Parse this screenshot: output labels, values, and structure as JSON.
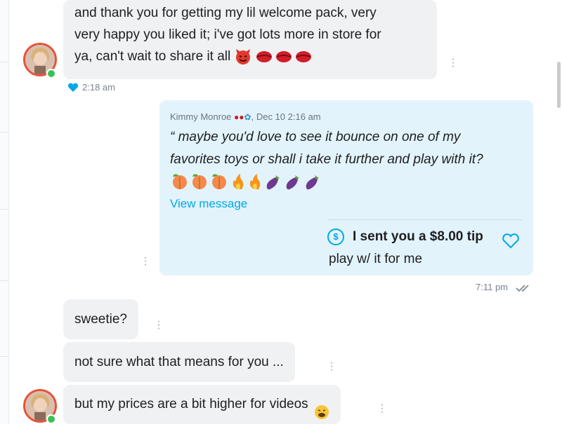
{
  "messages": {
    "welcome": {
      "line1": "and thank you for getting my lil welcome pack, very",
      "line2": "very happy you liked it; i've got lots more in store for",
      "line3": "ya, can't wait to share it all",
      "time": "2:18 am",
      "emojis": [
        "devil-emoji",
        "lips-emoji",
        "lips-emoji",
        "lips-emoji"
      ]
    },
    "quote": {
      "author": "Kimmy Monroe",
      "date": ", Dec 10 2:16 am",
      "line1": "“ maybe you'd love to see it bounce on one of my",
      "line2": "favorites toys or shall i take it further and play with it?",
      "link": "View message",
      "emojis": [
        "peach-emoji",
        "peach-emoji",
        "peach-emoji",
        "fire-emoji",
        "fire-emoji",
        "eggplant-emoji",
        "eggplant-emoji",
        "eggplant-emoji"
      ]
    },
    "tip": {
      "label": "I sent you a $8.00 tip",
      "note": "play w/ it for me",
      "time": "7:11 pm"
    },
    "sweetie": "sweetie?",
    "not_sure": "not sure what that means for you ...",
    "prices": "but my prices are a bit higher for videos"
  },
  "colors": {
    "incoming_bg": "#f0f1f3",
    "outgoing_bg": "#e2f3fc",
    "accent": "#00a8e6",
    "online": "#3ac058"
  }
}
